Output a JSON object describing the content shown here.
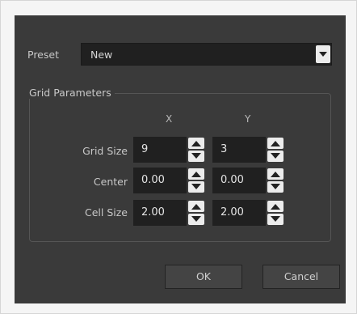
{
  "preset": {
    "label": "Preset",
    "value": "New"
  },
  "grid_parameters": {
    "title": "Grid Parameters",
    "column_x": "X",
    "column_y": "Y",
    "rows": [
      {
        "label": "Grid Size",
        "x": "9",
        "y": "3"
      },
      {
        "label": "Center",
        "x": "0.00",
        "y": "0.00"
      },
      {
        "label": "Cell Size",
        "x": "2.00",
        "y": "2.00"
      }
    ]
  },
  "buttons": {
    "ok": "OK",
    "cancel": "Cancel"
  },
  "icons": {
    "dropdown": "chevron-down-icon",
    "spin_up": "spin-up-arrow-icon",
    "spin_down": "spin-down-arrow-icon"
  },
  "colors": {
    "dialog_bg": "#3a3a3a",
    "field_bg": "#202020",
    "text": "#c8c8c8"
  }
}
